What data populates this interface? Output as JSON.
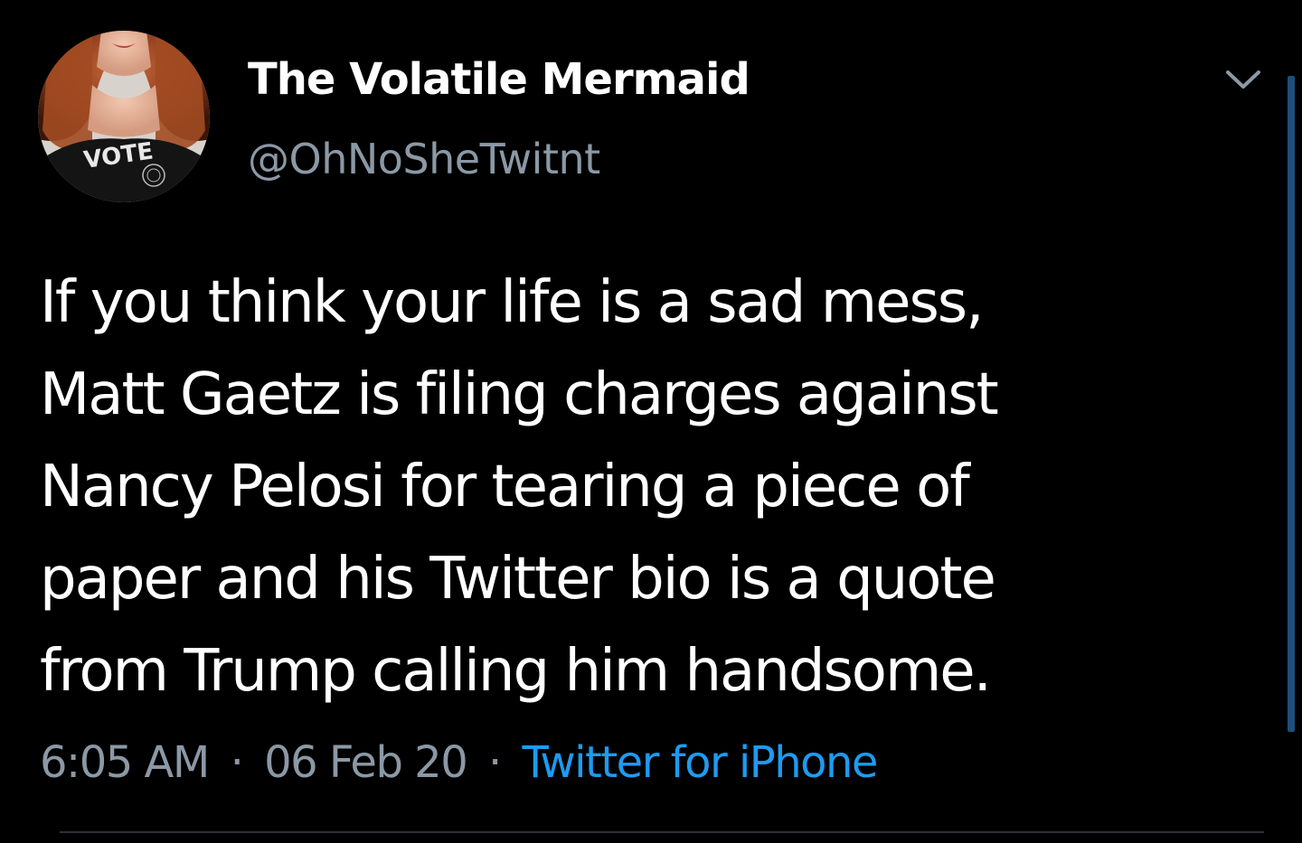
{
  "tweet": {
    "author": {
      "display_name": "The Volatile Mermaid",
      "handle": "@OhNoSheTwitnt",
      "avatar_shirt_text": "VOTE"
    },
    "text_lines": [
      "If you think your life is a sad mess,",
      "Matt Gaetz is filing charges against",
      "Nancy Pelosi for tearing a piece of",
      "paper and his Twitter bio is a quote",
      "from Trump calling him handsome."
    ],
    "time": "6:05 AM",
    "separator": "·",
    "date": "06 Feb 20",
    "source": "Twitter for iPhone",
    "menu_icon": "chevron-down-icon"
  },
  "colors": {
    "background": "#000000",
    "text_primary": "#ffffff",
    "text_secondary": "#8b98a5",
    "link": "#1d9bf0",
    "divider": "#2f3336",
    "scrollbar": "#1d4f7a"
  }
}
